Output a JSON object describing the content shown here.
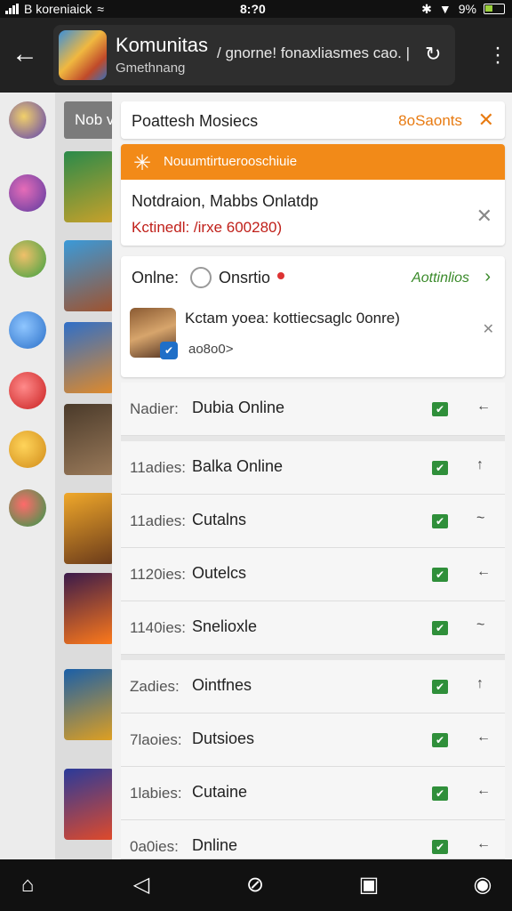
{
  "status_bar": {
    "carrier": "B koreniaick",
    "time": "8:?0",
    "battery": "9%"
  },
  "header": {
    "title": "Komunitas",
    "subtitle": "Gmethnang",
    "path": "/ gnorne! fonaxliasmes cao.",
    "separator": "|"
  },
  "sidebar": {
    "nob_label": "Nob v"
  },
  "notif_card": {
    "title": "Poattesh Mosiecs",
    "action": "8oSaonts"
  },
  "orange_card": {
    "banner": "Nouumtirtuerooschiuie",
    "line1": "Notdraion, Mabbs Onlatdp",
    "line2": "Kctinedl: /irxe 600280)"
  },
  "online_card": {
    "online_label": "Onlne:",
    "status": "Onsrtio",
    "link": "Aottinlios",
    "message": "Kctam yoea: kottiecsaglc 0onre)",
    "sub": "ao8o0>"
  },
  "rows": [
    {
      "key": "Nadier:",
      "val": "Dubia Online"
    },
    {
      "key": "11adies:",
      "val": "Balka Online"
    },
    {
      "key": "11adies:",
      "val": "Cutalns"
    },
    {
      "key": "1120ies:",
      "val": "Outelcs"
    },
    {
      "key": "1140ies:",
      "val": "Snelioxle"
    },
    {
      "key": "Zadies:",
      "val": "Ointfnes"
    },
    {
      "key": "7laoies:",
      "val": "Dutsioes"
    },
    {
      "key": "1labies:",
      "val": "Cutaine"
    },
    {
      "key": "0a0ies:",
      "val": "Dnline"
    }
  ],
  "icons": {
    "back": "arrow-left-icon",
    "refresh": "refresh-icon",
    "menu": "kebab-menu-icon"
  }
}
